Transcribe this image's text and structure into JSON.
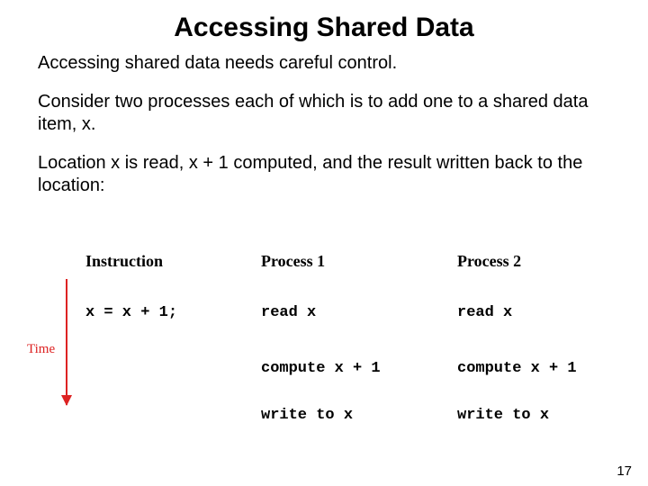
{
  "title": "Accessing Shared Data",
  "paragraphs": {
    "p1": "Accessing shared data needs careful control.",
    "p2": "Consider two processes each of which is to add one to a shared data item, x.",
    "p3": "Location x is read, x + 1 computed, and the result written back to the location:"
  },
  "diagram": {
    "headers": {
      "instruction": "Instruction",
      "process1": "Process 1",
      "process2": "Process 2"
    },
    "time_label": "Time",
    "rows": {
      "instruction_r1": "x = x + 1;",
      "p1_r1": "read x",
      "p2_r1": "read x",
      "p1_r2": "compute x + 1",
      "p2_r2": "compute x + 1",
      "p1_r3": "write to x",
      "p2_r3": "write to x"
    }
  },
  "page_number": "17"
}
